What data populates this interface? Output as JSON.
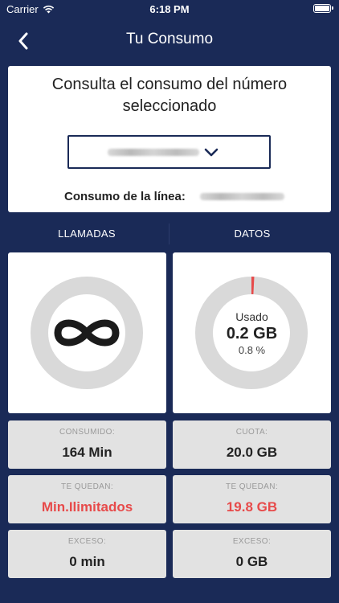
{
  "status_bar": {
    "carrier": "Carrier",
    "time": "6:18 PM"
  },
  "nav": {
    "title": "Tu Consumo"
  },
  "selector": {
    "title": "Consulta el consumo del número seleccionado",
    "line_label": "Consumo de la línea:"
  },
  "tabs": {
    "calls": "LLAMADAS",
    "data": "DATOS"
  },
  "data_gauge": {
    "used_label": "Usado",
    "used_value": "0.2 GB",
    "used_percent": "0.8 %",
    "fraction_used": 0.008
  },
  "calls_stats": {
    "consumed_label": "CONSUMIDO:",
    "consumed_value": "164 Min",
    "remaining_label": "TE QUEDAN:",
    "remaining_value": "Min.Ilimitados",
    "excess_label": "EXCESO:",
    "excess_value": "0 min"
  },
  "data_stats": {
    "quota_label": "CUOTA:",
    "quota_value": "20.0 GB",
    "remaining_label": "TE QUEDAN:",
    "remaining_value": "19.8 GB",
    "excess_label": "EXCESO:",
    "excess_value": "0 GB"
  },
  "colors": {
    "background": "#1a2a57",
    "card": "#ffffff",
    "stat_card": "#e2e2e2",
    "ring": "#d9d9d9",
    "accent_red": "#e74a4a"
  },
  "icons": {
    "back": "chevron-left-icon",
    "dropdown": "chevron-down-icon",
    "unlimited": "infinity-icon",
    "wifi": "wifi-icon",
    "battery": "battery-icon"
  }
}
